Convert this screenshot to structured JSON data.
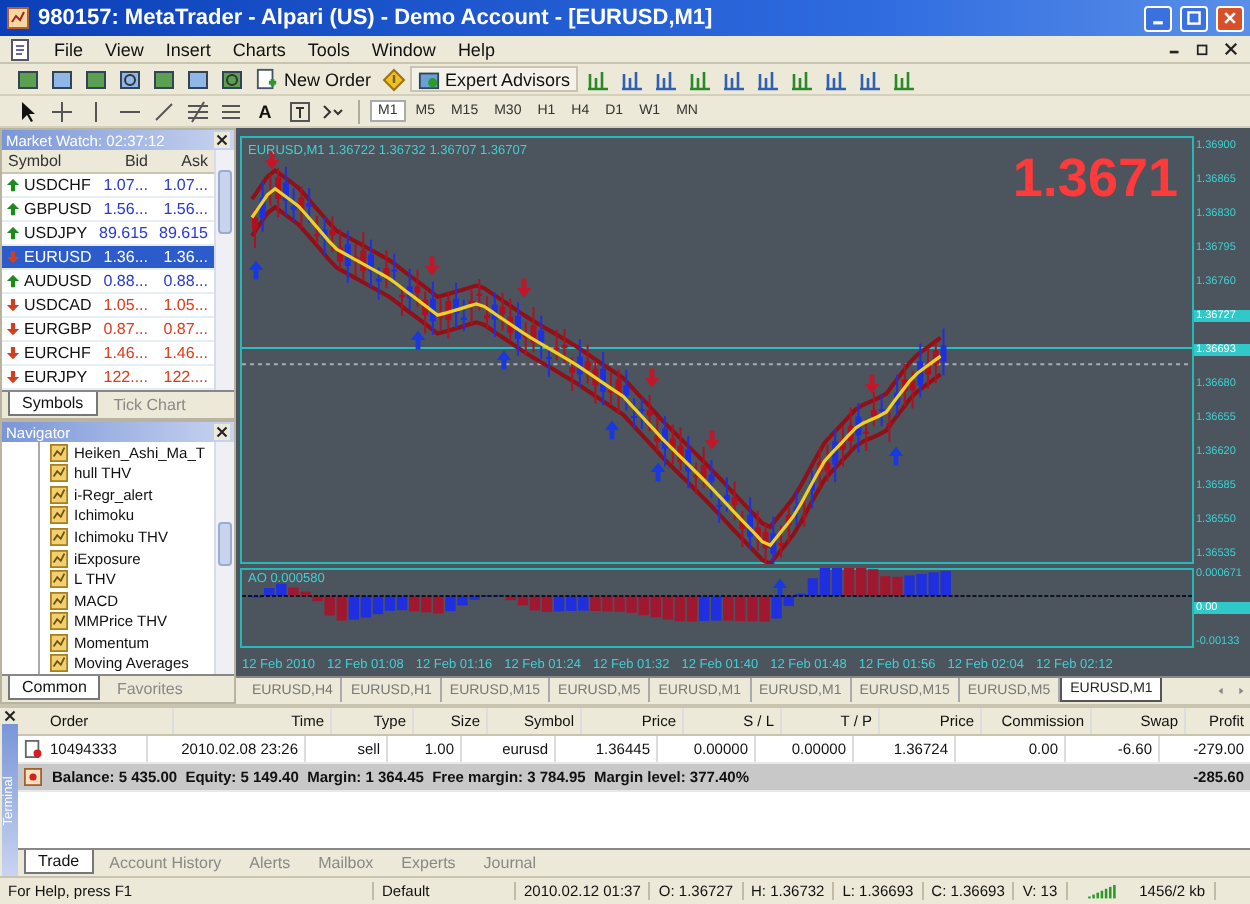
{
  "window": {
    "title": "980157: MetaTrader - Alpari (US) - Demo Account - [EURUSD,M1]"
  },
  "menu": [
    "File",
    "View",
    "Insert",
    "Charts",
    "Tools",
    "Window",
    "Help"
  ],
  "toolbar": {
    "new_order": "New Order",
    "expert_advisors": "Expert Advisors",
    "text_tool": "A",
    "timeframes": [
      {
        "label": "M1",
        "selected": true
      },
      {
        "label": "M5",
        "selected": false
      },
      {
        "label": "M15",
        "selected": false
      },
      {
        "label": "M30",
        "selected": false
      },
      {
        "label": "H1",
        "selected": false
      },
      {
        "label": "H4",
        "selected": false
      },
      {
        "label": "D1",
        "selected": false
      },
      {
        "label": "W1",
        "selected": false
      },
      {
        "label": "MN",
        "selected": false
      }
    ]
  },
  "market_watch": {
    "title": "Market Watch: 02:37:12",
    "columns": [
      "Symbol",
      "Bid",
      "Ask"
    ],
    "rows": [
      {
        "symbol": "USDCHF",
        "bid": "1.07...",
        "ask": "1.07...",
        "rising": true,
        "selected": false
      },
      {
        "symbol": "GBPUSD",
        "bid": "1.56...",
        "ask": "1.56...",
        "rising": true,
        "selected": false
      },
      {
        "symbol": "USDJPY",
        "bid": "89.615",
        "ask": "89.615",
        "rising": true,
        "selected": false
      },
      {
        "symbol": "EURUSD",
        "bid": "1.36...",
        "ask": "1.36...",
        "rising": false,
        "selected": true
      },
      {
        "symbol": "AUDUSD",
        "bid": "0.88...",
        "ask": "0.88...",
        "rising": true,
        "selected": false
      },
      {
        "symbol": "USDCAD",
        "bid": "1.05...",
        "ask": "1.05...",
        "rising": false,
        "selected": false
      },
      {
        "symbol": "EURGBP",
        "bid": "0.87...",
        "ask": "0.87...",
        "rising": false,
        "selected": false
      },
      {
        "symbol": "EURCHF",
        "bid": "1.46...",
        "ask": "1.46...",
        "rising": false,
        "selected": false
      },
      {
        "symbol": "EURJPY",
        "bid": "122....",
        "ask": "122....",
        "rising": false,
        "selected": false
      }
    ],
    "tabs": [
      {
        "label": "Symbols",
        "selected": true
      },
      {
        "label": "Tick Chart",
        "selected": false
      }
    ]
  },
  "navigator": {
    "title": "Navigator",
    "items": [
      "Heiken_Ashi_Ma_T",
      "hull THV",
      "i-Regr_alert",
      "Ichimoku",
      "Ichimoku THV",
      "iExposure",
      "L THV",
      "MACD",
      "MMPrice THV",
      "Momentum",
      "Moving Averages"
    ],
    "tabs": [
      {
        "label": "Common",
        "selected": true
      },
      {
        "label": "Favorites",
        "selected": false
      }
    ]
  },
  "chart": {
    "symbol": "EURUSD,M1",
    "ohlc": "1.36722 1.36732 1.36707 1.36707",
    "big_price": "1.3671",
    "price_axis": [
      {
        "label": "1.36900",
        "kind": "plain"
      },
      {
        "label": "1.36865",
        "kind": "plain"
      },
      {
        "label": "1.36830",
        "kind": "plain"
      },
      {
        "label": "1.36795",
        "kind": "plain"
      },
      {
        "label": "1.36760",
        "kind": "plain"
      },
      {
        "label": "1.36727",
        "kind": "marker"
      },
      {
        "label": "1.36693",
        "kind": "marker"
      },
      {
        "label": "1.36680",
        "kind": "plain"
      },
      {
        "label": "1.36655",
        "kind": "plain"
      },
      {
        "label": "1.36620",
        "kind": "plain"
      },
      {
        "label": "1.36585",
        "kind": "plain"
      },
      {
        "label": "1.36550",
        "kind": "plain"
      },
      {
        "label": "1.36535",
        "kind": "plain"
      }
    ],
    "oscillator": {
      "label": "AO 0.000580",
      "axis": [
        {
          "label": "0.000671",
          "kind": "plain"
        },
        {
          "label": "0.00",
          "kind": "marker"
        },
        {
          "label": "-0.00133",
          "kind": "plain"
        }
      ]
    },
    "time_axis": [
      "12 Feb 2010",
      "12 Feb 01:08",
      "12 Feb 01:16",
      "12 Feb 01:24",
      "12 Feb 01:32",
      "12 Feb 01:40",
      "12 Feb 01:48",
      "12 Feb 01:56",
      "12 Feb 02:04",
      "12 Feb 02:12"
    ]
  },
  "chart_tabs": [
    {
      "label": "EURUSD,H4",
      "selected": false
    },
    {
      "label": "EURUSD,H1",
      "selected": false
    },
    {
      "label": "EURUSD,M15",
      "selected": false
    },
    {
      "label": "EURUSD,M5",
      "selected": false
    },
    {
      "label": "EURUSD,M1",
      "selected": false
    },
    {
      "label": "EURUSD,M1",
      "selected": false
    },
    {
      "label": "EURUSD,M15",
      "selected": false
    },
    {
      "label": "EURUSD,M5",
      "selected": false
    },
    {
      "label": "EURUSD,M1",
      "selected": true
    }
  ],
  "terminal": {
    "title": "Terminal",
    "columns": [
      "Order",
      "Time",
      "Type",
      "Size",
      "Symbol",
      "Price",
      "S / L",
      "T / P",
      "Price",
      "Commission",
      "Swap",
      "Profit"
    ],
    "orders": [
      [
        "10494333",
        "2010.02.08 23:26",
        "sell",
        "1.00",
        "eurusd",
        "1.36445",
        "0.00000",
        "0.00000",
        "1.36724",
        "0.00",
        "-6.60",
        "-279.00"
      ]
    ],
    "summary": {
      "text": "Balance: 5 435.00  Equity: 5 149.40  Margin: 1 364.45  Free margin: 3 784.95  Margin level: 377.40%",
      "profit": "-285.60"
    },
    "tabs": [
      {
        "label": "Trade",
        "selected": true
      },
      {
        "label": "Account History",
        "selected": false
      },
      {
        "label": "Alerts",
        "selected": false
      },
      {
        "label": "Mailbox",
        "selected": false
      },
      {
        "label": "Experts",
        "selected": false
      },
      {
        "label": "Journal",
        "selected": false
      }
    ]
  },
  "status_bar": {
    "help": "For Help, press F1",
    "profile": "Default",
    "time": "2010.02.12 01:37",
    "open": "O: 1.36727",
    "high": "H: 1.36732",
    "low": "L: 1.36693",
    "close": "C: 1.36693",
    "volume": "V: 13",
    "traffic": "1456/2 kb"
  }
}
